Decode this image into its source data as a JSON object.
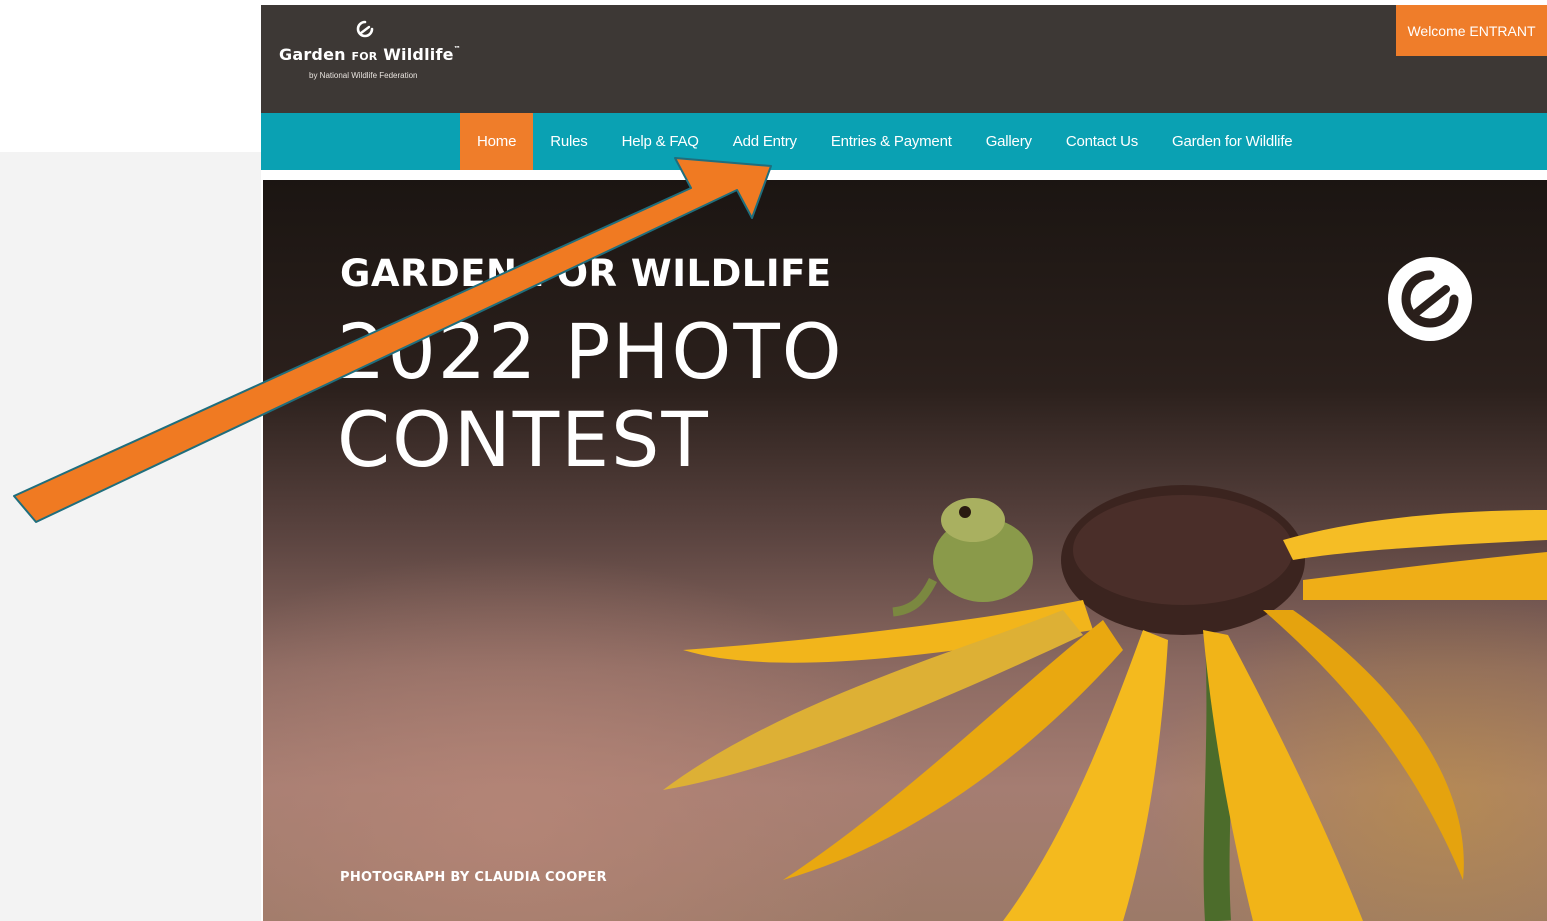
{
  "header": {
    "brand_name": "Garden FOR Wildlife",
    "brand_main": "Garden ",
    "brand_for": "FOR",
    "brand_end": " Wildlife",
    "brand_tm": "™",
    "brand_subtitle": "by National Wildlife Federation",
    "welcome_label": "Welcome ENTRANT"
  },
  "nav": {
    "items": [
      {
        "label": "Home",
        "active": true
      },
      {
        "label": "Rules"
      },
      {
        "label": "Help & FAQ"
      },
      {
        "label": "Add Entry"
      },
      {
        "label": "Entries & Payment"
      },
      {
        "label": "Gallery"
      },
      {
        "label": "Contact Us"
      },
      {
        "label": "Garden for Wildlife"
      }
    ]
  },
  "hero": {
    "eyebrow": "GARDEN FOR WILDLIFE",
    "title": "2022 PHOTO\nCONTEST",
    "credit": "PHOTOGRAPH BY CLAUDIA COOPER"
  },
  "annotation": {
    "arrow_color": "#f07a22",
    "arrow_outline": "#1f6e7d",
    "points_to": "Add Entry"
  },
  "colors": {
    "header_bg": "#3d3835",
    "nav_bg": "#0aa1b3",
    "accent": "#ef7d2a",
    "sidebar_bg": "#f3f3f3"
  },
  "icons": {
    "brand_logo": "garden-for-wildlife-g-icon"
  }
}
